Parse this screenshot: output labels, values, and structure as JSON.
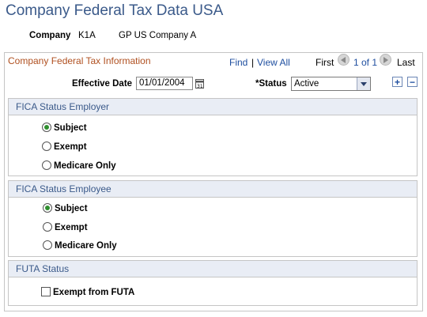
{
  "page_title": "Company Federal Tax Data USA",
  "company": {
    "label": "Company",
    "code": "K1A",
    "name": "GP US Company A"
  },
  "grid": {
    "title": "Company Federal Tax Information",
    "find": "Find",
    "separator": "|",
    "view_all": "View All",
    "first": "First",
    "position": "1 of 1",
    "last": "Last"
  },
  "effective_date": {
    "label": "Effective Date",
    "value": "01/01/2004"
  },
  "status": {
    "label": "*Status",
    "value": "Active"
  },
  "row_buttons": {
    "add": "+",
    "delete": "−"
  },
  "fica_employer": {
    "title": "FICA Status Employer",
    "options": [
      "Subject",
      "Exempt",
      "Medicare Only"
    ],
    "selected": "Subject"
  },
  "fica_employee": {
    "title": "FICA Status Employee",
    "options": [
      "Subject",
      "Exempt",
      "Medicare Only"
    ],
    "selected": "Subject"
  },
  "futa": {
    "title": "FUTA Status",
    "checkbox_label": "Exempt from FUTA",
    "checked": false
  },
  "colors": {
    "title": "#3b5a8a",
    "grid_title": "#b05020",
    "link": "#1f4fa0",
    "section_header_bg": "#e9edf5",
    "radio_selected": "#2f8f2f"
  }
}
